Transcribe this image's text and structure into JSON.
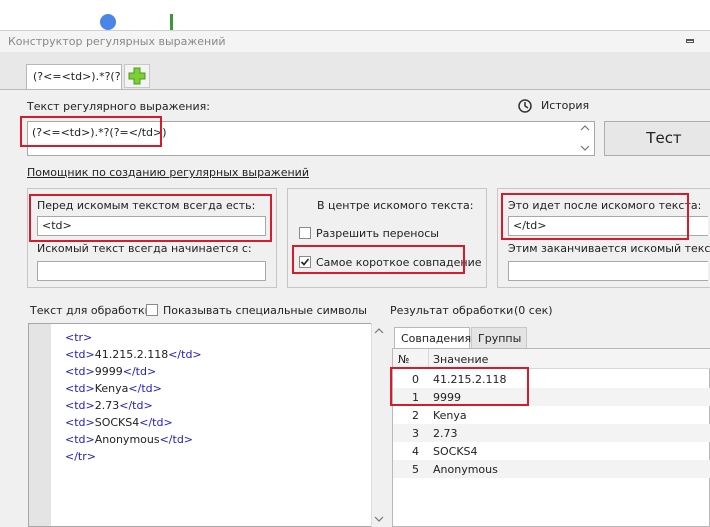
{
  "window": {
    "title": "Конструктор регулярных выражений"
  },
  "tabs": {
    "active_label": "(?<=<td>).*?(?",
    "add_icon": "plus-icon"
  },
  "regex": {
    "label": "Текст регулярного выражения:",
    "value": "(?<=<td>).*?(?=</td>)",
    "history_label": "История",
    "test_button": "Тест"
  },
  "helper": {
    "link": "Помощник по созданию регулярных выражений",
    "before_label": "Перед искомым текстом всегда есть:",
    "before_value": "<td>",
    "starts_label": "Искомый текст всегда начинается с:",
    "starts_value": "",
    "center_label": "В центре искомого текста:",
    "allow_wrap_label": "Разрешить переносы",
    "allow_wrap_checked": false,
    "shortest_label": "Самое короткое совпадение",
    "shortest_checked": true,
    "after_label": "Это идет после искомого текста:",
    "after_value": "</td>",
    "ends_label": "Этим заканчивается искомый текст:",
    "ends_value": ""
  },
  "input_text": {
    "label": "Текст для обработки",
    "show_special_label": "Показывать специальные символы",
    "show_special_checked": false,
    "lines": [
      {
        "pre": "<tr>",
        "text": "",
        "post": ""
      },
      {
        "pre": "<td>",
        "text": "41.215.2.118",
        "post": "</td>"
      },
      {
        "pre": "<td>",
        "text": "9999",
        "post": "</td>"
      },
      {
        "pre": "<td>",
        "text": "Kenya",
        "post": "</td>"
      },
      {
        "pre": "<td>",
        "text": "2.73",
        "post": "</td>"
      },
      {
        "pre": "<td>",
        "text": "SOCKS4",
        "post": "</td>"
      },
      {
        "pre": "<td>",
        "text": "Anonymous",
        "post": "</td>"
      },
      {
        "pre": "</tr>",
        "text": "",
        "post": ""
      }
    ]
  },
  "result": {
    "label": "Результат обработки",
    "time": "(0 сек)",
    "tab_matches": "Совпадения",
    "tab_groups": "Группы",
    "col_num": "№",
    "col_value": "Значение",
    "rows": [
      {
        "num": "0",
        "value": "41.215.2.118"
      },
      {
        "num": "1",
        "value": "9999"
      },
      {
        "num": "2",
        "value": "Kenya"
      },
      {
        "num": "3",
        "value": "2.73"
      },
      {
        "num": "4",
        "value": "SOCKS4"
      },
      {
        "num": "5",
        "value": "Anonymous"
      }
    ]
  }
}
